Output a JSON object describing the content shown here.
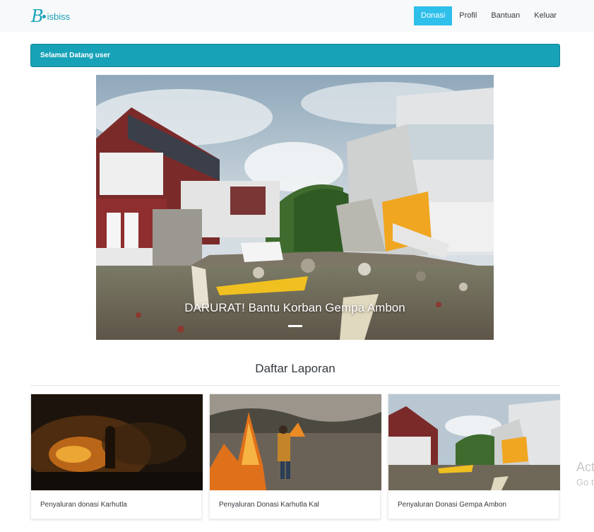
{
  "brand": {
    "name": "isbiss",
    "logo_letter": "B"
  },
  "nav": {
    "items": [
      {
        "label": "Donasi",
        "active": true
      },
      {
        "label": "Profil",
        "active": false
      },
      {
        "label": "Bantuan",
        "active": false
      },
      {
        "label": "Keluar",
        "active": false
      }
    ]
  },
  "alert": {
    "text": "Selamat Datang user"
  },
  "carousel": {
    "caption": "DARURAT! Bantu Korban Gempa Ambon",
    "slide_count": 1,
    "active_slide": 1
  },
  "section": {
    "title": "Daftar Laporan"
  },
  "cards": [
    {
      "title": "Penyaluran donasi Karhutla"
    },
    {
      "title": "Penyaluran Donasi Karhutla Kal"
    },
    {
      "title": "Penyaluran Donasi Gempa Ambon"
    }
  ],
  "watermark": {
    "line1": "Act",
    "line2": "Go t"
  },
  "colors": {
    "primary": "#2ebfea",
    "info": "#17a2b8",
    "navbar_bg": "#f8f9fa"
  }
}
